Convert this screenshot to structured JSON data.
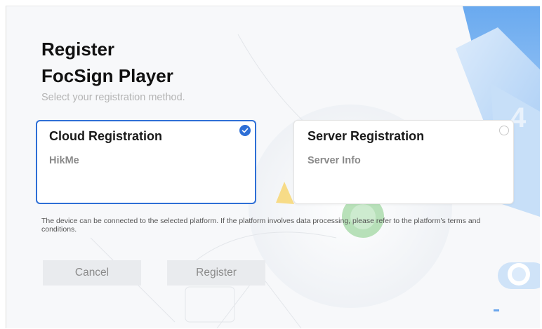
{
  "header": {
    "title_line1": "Register",
    "title_line2": "FocSign Player",
    "subtitle": "Select your registration method."
  },
  "options": [
    {
      "title": "Cloud Registration",
      "subtitle": "HikMe",
      "selected": true
    },
    {
      "title": "Server Registration",
      "subtitle": "Server Info",
      "selected": false
    }
  ],
  "notice": "The device can be connected to the selected platform. If the platform involves data processing, please refer to the platform's terms and conditions.",
  "buttons": {
    "cancel": "Cancel",
    "register": "Register"
  },
  "colors": {
    "accent": "#2e6fd6",
    "button_bg": "#e9ebee",
    "subtitle_text": "#b4b4b4"
  },
  "icons": {
    "selected": "check-circle-icon",
    "unselected": "radio-empty-icon"
  }
}
